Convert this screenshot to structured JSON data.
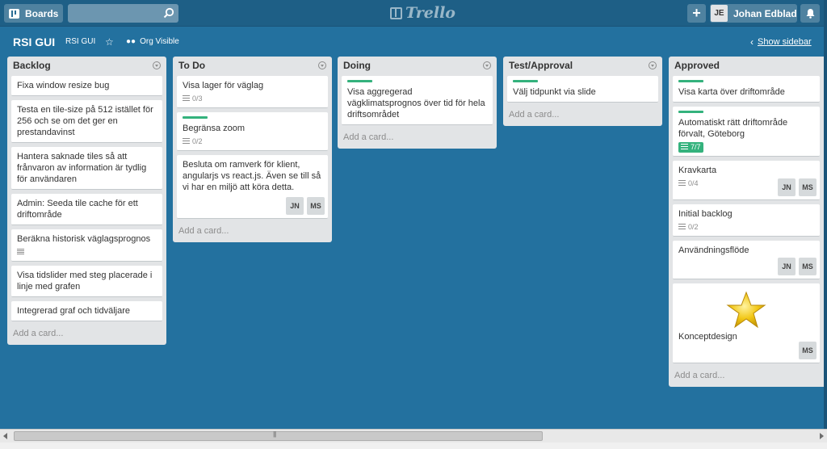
{
  "header": {
    "boards_label": "Boards",
    "search_placeholder": "",
    "logo_text": "Trello",
    "add_label": "+",
    "user_initials": "JE",
    "user_name": "Johan Edblad"
  },
  "board": {
    "title": "RSI GUI",
    "org": "RSI GUI",
    "visibility": "Org Visible",
    "show_sidebar": "Show sidebar"
  },
  "add_card_label": "Add a card...",
  "lists": [
    {
      "title": "Backlog",
      "cards": [
        {
          "text": "Fixa window resize bug"
        },
        {
          "text": "Testa en tile-size på 512 istället för 256 och se om det ger en prestandavinst"
        },
        {
          "text": "Hantera saknade tiles så att frånvaron av information är tydlig för användaren"
        },
        {
          "text": "Admin: Seeda tile cache för ett driftområde"
        },
        {
          "text": "Beräkna historisk väglagsprognos",
          "has_description": true
        },
        {
          "text": "Visa tidslider med steg placerade i linje med grafen"
        },
        {
          "text": "Integrerad graf och tidväljare"
        }
      ]
    },
    {
      "title": "To Do",
      "cards": [
        {
          "text": "Visa lager för väglag",
          "checklist": "0/3"
        },
        {
          "text": "Begränsa zoom",
          "checklist": "0/2",
          "label": "green"
        },
        {
          "text": "Besluta om ramverk för klient, angularjs vs react.js. Även se till så vi har en miljö att köra detta.",
          "members": [
            "JN",
            "MS"
          ]
        }
      ]
    },
    {
      "title": "Doing",
      "cards": [
        {
          "text": "Visa aggregerad vägklimatsprognos över tid för hela driftsområdet",
          "label": "green"
        }
      ]
    },
    {
      "title": "Test/Approval",
      "cards": [
        {
          "text": "Välj tidpunkt via slide",
          "label": "green"
        }
      ]
    },
    {
      "title": "Approved",
      "cards": [
        {
          "text": "Visa karta över driftområde",
          "label": "green"
        },
        {
          "text": "Automatiskt rätt driftområde förvalt, Göteborg",
          "label": "green",
          "checklist_done": "7/7"
        },
        {
          "text": "Kravkarta",
          "checklist": "0/4",
          "members": [
            "JN",
            "MS"
          ]
        },
        {
          "text": "Initial backlog",
          "checklist": "0/2"
        },
        {
          "text": "Användningsflöde",
          "members": [
            "JN",
            "MS"
          ]
        },
        {
          "text": "Konceptdesign",
          "cover": "star",
          "members": [
            "MS"
          ]
        }
      ]
    }
  ],
  "colors": {
    "board_bg": "#23719f",
    "header_bg": "#1e5f86",
    "label_green": "#34b27d",
    "list_bg": "#e2e4e6"
  },
  "icons": [
    "boards-icon",
    "search-icon",
    "trello-logo-icon",
    "plus-icon",
    "bell-icon",
    "star-icon",
    "org-visibility-icon",
    "chevron-left-icon",
    "list-menu-icon",
    "checklist-icon",
    "description-icon"
  ]
}
